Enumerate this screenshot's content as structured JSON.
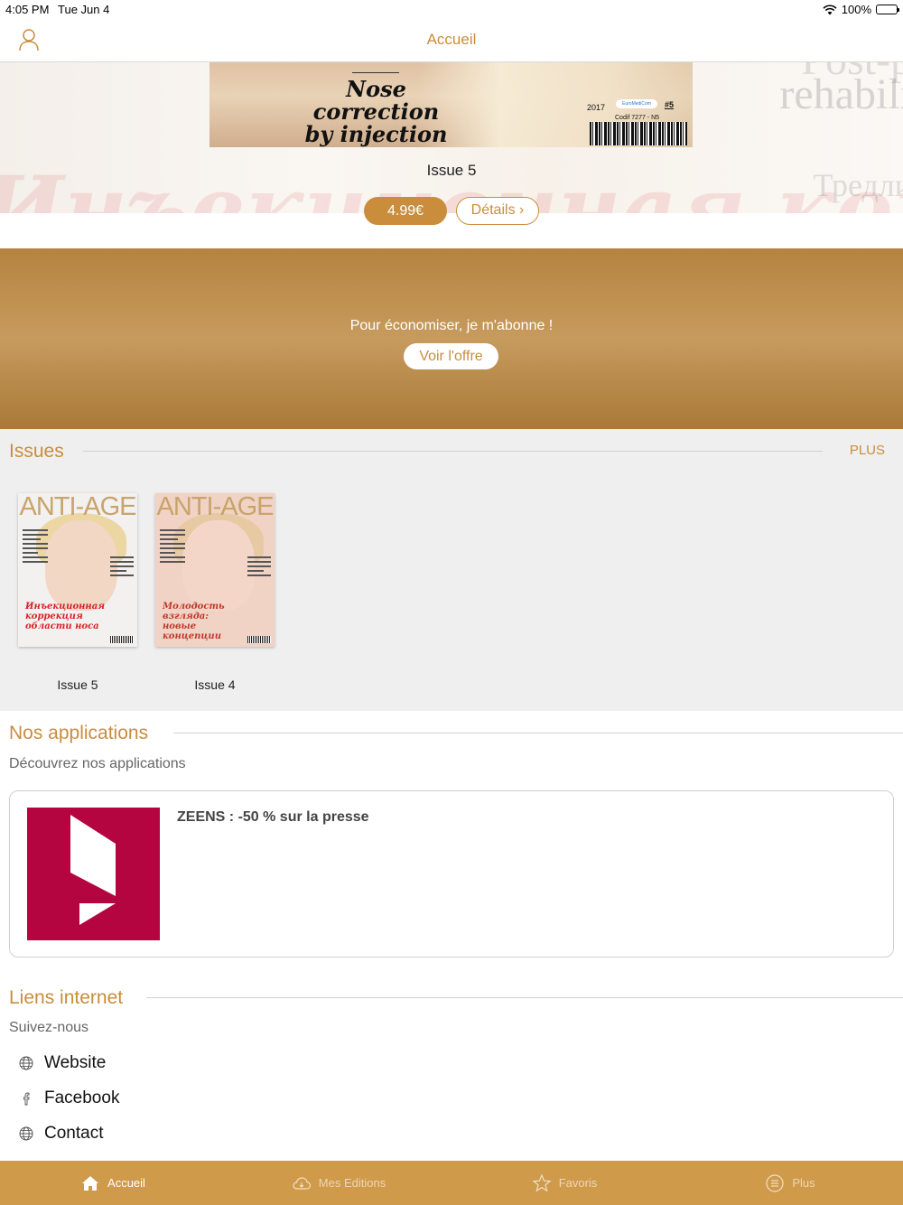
{
  "status": {
    "time": "4:05 PM",
    "date": "Tue Jun 4",
    "battery": "100%"
  },
  "nav": {
    "title": "Accueil"
  },
  "hero": {
    "headline_line1": "Nose correction",
    "headline_line2": "by injection",
    "cover_year": "2017",
    "cover_issue_no": "#5",
    "cover_codif": "Codif 7277 - N5",
    "background_side_text_1": "rehabili",
    "background_side_text_2": "Тредли",
    "background_side_text_0": "Post-p",
    "issue_title": "Issue 5",
    "price": "4.99€",
    "details": "Détails ›"
  },
  "promo": {
    "text": "Pour économiser, je m'abonne !",
    "button": "Voir l'offre"
  },
  "issues": {
    "title": "Issues",
    "more": "PLUS",
    "items": [
      {
        "label": "Issue 5",
        "masthead": "ANTI-AGE",
        "cover_headline": "Инъекционная коррекция области носа",
        "accent": "#d8232a"
      },
      {
        "label": "Issue 4",
        "masthead": "ANTI-AGE",
        "cover_headline": "Молодость взгляда: новые концепции",
        "accent": "#c0392b"
      }
    ]
  },
  "apps": {
    "title": "Nos applications",
    "subtitle": "Découvrez nos applications",
    "items": [
      {
        "name": "ZEENS : -50 % sur la presse",
        "icon_color": "#b50541"
      }
    ]
  },
  "links": {
    "title": "Liens internet",
    "subtitle": "Suivez-nous",
    "items": [
      {
        "label": "Website",
        "icon": "globe-icon"
      },
      {
        "label": "Facebook",
        "icon": "facebook-icon"
      },
      {
        "label": "Contact",
        "icon": "globe-icon"
      }
    ]
  },
  "tabs": [
    {
      "label": "Accueil",
      "icon": "home-icon",
      "active": true
    },
    {
      "label": "Mes Editions",
      "icon": "cloud-download-icon",
      "active": false
    },
    {
      "label": "Favoris",
      "icon": "star-icon",
      "active": false
    },
    {
      "label": "Plus",
      "icon": "menu-icon",
      "active": false
    }
  ],
  "colors": {
    "accent": "#c98d3c",
    "tab_bar": "#cf9a4a",
    "promo": "#b5833f"
  }
}
